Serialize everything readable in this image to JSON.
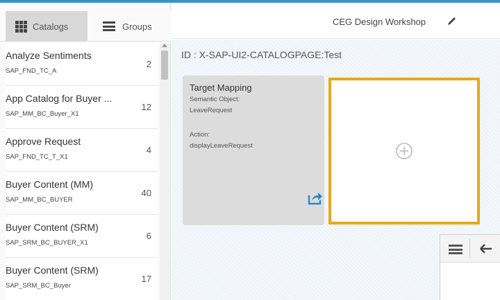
{
  "tabs": {
    "catalogs": "Catalogs",
    "groups": "Groups"
  },
  "catalogs": [
    {
      "title": "Analyze Sentiments",
      "id": "SAP_FND_TC_A",
      "count": "2"
    },
    {
      "title": "App Catalog for Buyer ...",
      "id": "SAP_MM_BC_Buyer_X1",
      "count": "12"
    },
    {
      "title": "Approve Request",
      "id": "SAP_FND_TC_T_X1",
      "count": "4"
    },
    {
      "title": "Buyer Content (MM)",
      "id": "SAP_MM_BC_BUYER",
      "count": "40"
    },
    {
      "title": "Buyer Content (SRM)",
      "id": "SAP_SRM_BC_BUYER_X1",
      "count": "6"
    },
    {
      "title": "Buyer Content (SRM)",
      "id": "SAP_SRM_BC_Buyer",
      "count": "17"
    }
  ],
  "header": {
    "title": "CEG Design Workshop"
  },
  "main": {
    "page_id": "ID : X-SAP-UI2-CATALOGPAGE:Test",
    "tile": {
      "title": "Target Mapping",
      "semantic_label": "Semantic Object:",
      "semantic_value": "LeaveRequest",
      "action_label": "Action:",
      "action_value": "displayLeaveRequest"
    }
  },
  "colors": {
    "accent": "#3a93c6",
    "highlight": "#e8a81b",
    "share_icon": "#2a87c8"
  },
  "icons": [
    "grid-icon",
    "menu-icon",
    "pencil-icon",
    "share-icon",
    "plus-circle-icon",
    "back-arrow-icon"
  ]
}
